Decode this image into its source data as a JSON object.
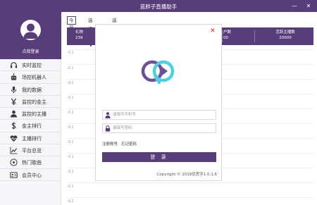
{
  "window": {
    "title": "蓝胖子直播助手",
    "minimize_icon": "minimize-icon",
    "close_icon": "close-icon"
  },
  "sidebar": {
    "login_link": "点我登录",
    "items": [
      {
        "label": "实时监控",
        "icon": "headset-icon"
      },
      {
        "label": "场控机器人",
        "icon": "robot-icon"
      },
      {
        "label": "我的数据",
        "icon": "microphone-icon"
      },
      {
        "label": "监控的金主",
        "icon": "yen-icon"
      },
      {
        "label": "监控的主播",
        "icon": "user-icon"
      },
      {
        "label": "金主排行",
        "icon": "dollar-icon"
      },
      {
        "label": "主播排行",
        "icon": "heartbeat-icon"
      },
      {
        "label": "平台总览",
        "icon": "line-chart-icon"
      },
      {
        "label": "热门歌曲",
        "icon": "music-icon"
      },
      {
        "label": "会员中心",
        "icon": "id-card-icon"
      }
    ]
  },
  "filters": {
    "today": "今日",
    "select_platform": "选择/画",
    "select_month": "选择月"
  },
  "stats": [
    {
      "label": "礼物",
      "value": "239"
    },
    {
      "label": "户数",
      "value": "00"
    },
    {
      "label": "活跃主播数",
      "value": "20000"
    }
  ],
  "chart_ticks": [
    "-0.1",
    "-0.1",
    "-0.1",
    "-0.1",
    "-0.1",
    "-0.1",
    "-0.1",
    "-0.1",
    "-0.1",
    "-0.1",
    "-0.1"
  ],
  "login_modal": {
    "phone_placeholder": "请填写手机号",
    "password_placeholder": "请填写密码",
    "register_link": "注册账号",
    "forgot_link": "忘记密码",
    "login_button": "登 录",
    "copyright": "Copyright ©   2018优思亨1.0.1.6",
    "accent_color": "#573e7b",
    "close_color": "#e02020"
  }
}
